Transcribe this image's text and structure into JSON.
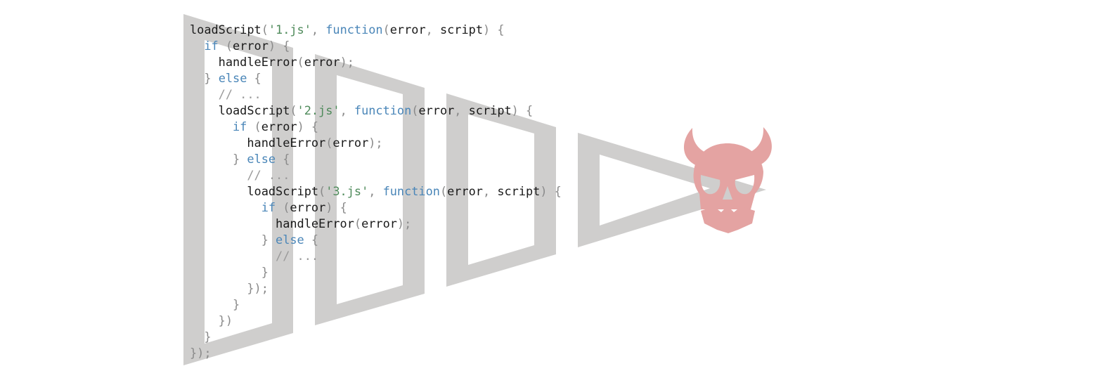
{
  "colors": {
    "pyramid": "#cfcecd",
    "skull": "#e4a3a2",
    "keyword": "#4a86b8",
    "string": "#4e8a5a",
    "comment": "#9a9a9a",
    "punctuation": "#8a8a8a",
    "plain": "#1a1a1a"
  },
  "icons": {
    "pyramid": "nested-pyramid-arrow-icon",
    "skull": "devil-skull-icon"
  },
  "code_lines": [
    [
      {
        "t": "plain",
        "v": "loadScript"
      },
      {
        "t": "punct",
        "v": "("
      },
      {
        "t": "string",
        "v": "'1.js'"
      },
      {
        "t": "punct",
        "v": ", "
      },
      {
        "t": "keyword",
        "v": "function"
      },
      {
        "t": "punct",
        "v": "("
      },
      {
        "t": "plain",
        "v": "error"
      },
      {
        "t": "punct",
        "v": ", "
      },
      {
        "t": "plain",
        "v": "script"
      },
      {
        "t": "punct",
        "v": ") {"
      }
    ],
    [
      {
        "t": "plain",
        "v": "  "
      },
      {
        "t": "keyword",
        "v": "if"
      },
      {
        "t": "punct",
        "v": " ("
      },
      {
        "t": "plain",
        "v": "error"
      },
      {
        "t": "punct",
        "v": ") {"
      }
    ],
    [
      {
        "t": "plain",
        "v": "    handleError"
      },
      {
        "t": "punct",
        "v": "("
      },
      {
        "t": "plain",
        "v": "error"
      },
      {
        "t": "punct",
        "v": ");"
      }
    ],
    [
      {
        "t": "punct",
        "v": "  } "
      },
      {
        "t": "keyword",
        "v": "else"
      },
      {
        "t": "punct",
        "v": " {"
      }
    ],
    [
      {
        "t": "comment",
        "v": "    // ..."
      }
    ],
    [
      {
        "t": "plain",
        "v": "    loadScript"
      },
      {
        "t": "punct",
        "v": "("
      },
      {
        "t": "string",
        "v": "'2.js'"
      },
      {
        "t": "punct",
        "v": ", "
      },
      {
        "t": "keyword",
        "v": "function"
      },
      {
        "t": "punct",
        "v": "("
      },
      {
        "t": "plain",
        "v": "error"
      },
      {
        "t": "punct",
        "v": ", "
      },
      {
        "t": "plain",
        "v": "script"
      },
      {
        "t": "punct",
        "v": ") {"
      }
    ],
    [
      {
        "t": "plain",
        "v": "      "
      },
      {
        "t": "keyword",
        "v": "if"
      },
      {
        "t": "punct",
        "v": " ("
      },
      {
        "t": "plain",
        "v": "error"
      },
      {
        "t": "punct",
        "v": ") {"
      }
    ],
    [
      {
        "t": "plain",
        "v": "        handleError"
      },
      {
        "t": "punct",
        "v": "("
      },
      {
        "t": "plain",
        "v": "error"
      },
      {
        "t": "punct",
        "v": ");"
      }
    ],
    [
      {
        "t": "punct",
        "v": "      } "
      },
      {
        "t": "keyword",
        "v": "else"
      },
      {
        "t": "punct",
        "v": " {"
      }
    ],
    [
      {
        "t": "comment",
        "v": "        // ..."
      }
    ],
    [
      {
        "t": "plain",
        "v": "        loadScript"
      },
      {
        "t": "punct",
        "v": "("
      },
      {
        "t": "string",
        "v": "'3.js'"
      },
      {
        "t": "punct",
        "v": ", "
      },
      {
        "t": "keyword",
        "v": "function"
      },
      {
        "t": "punct",
        "v": "("
      },
      {
        "t": "plain",
        "v": "error"
      },
      {
        "t": "punct",
        "v": ", "
      },
      {
        "t": "plain",
        "v": "script"
      },
      {
        "t": "punct",
        "v": ") {"
      }
    ],
    [
      {
        "t": "plain",
        "v": "          "
      },
      {
        "t": "keyword",
        "v": "if"
      },
      {
        "t": "punct",
        "v": " ("
      },
      {
        "t": "plain",
        "v": "error"
      },
      {
        "t": "punct",
        "v": ") {"
      }
    ],
    [
      {
        "t": "plain",
        "v": "            handleError"
      },
      {
        "t": "punct",
        "v": "("
      },
      {
        "t": "plain",
        "v": "error"
      },
      {
        "t": "punct",
        "v": ");"
      }
    ],
    [
      {
        "t": "punct",
        "v": "          } "
      },
      {
        "t": "keyword",
        "v": "else"
      },
      {
        "t": "punct",
        "v": " {"
      }
    ],
    [
      {
        "t": "comment",
        "v": "            // ..."
      }
    ],
    [
      {
        "t": "punct",
        "v": "          }"
      }
    ],
    [
      {
        "t": "punct",
        "v": "        });"
      }
    ],
    [
      {
        "t": "punct",
        "v": "      }"
      }
    ],
    [
      {
        "t": "punct",
        "v": "    })"
      }
    ],
    [
      {
        "t": "punct",
        "v": "  }"
      }
    ],
    [
      {
        "t": "punct",
        "v": "});"
      }
    ]
  ]
}
